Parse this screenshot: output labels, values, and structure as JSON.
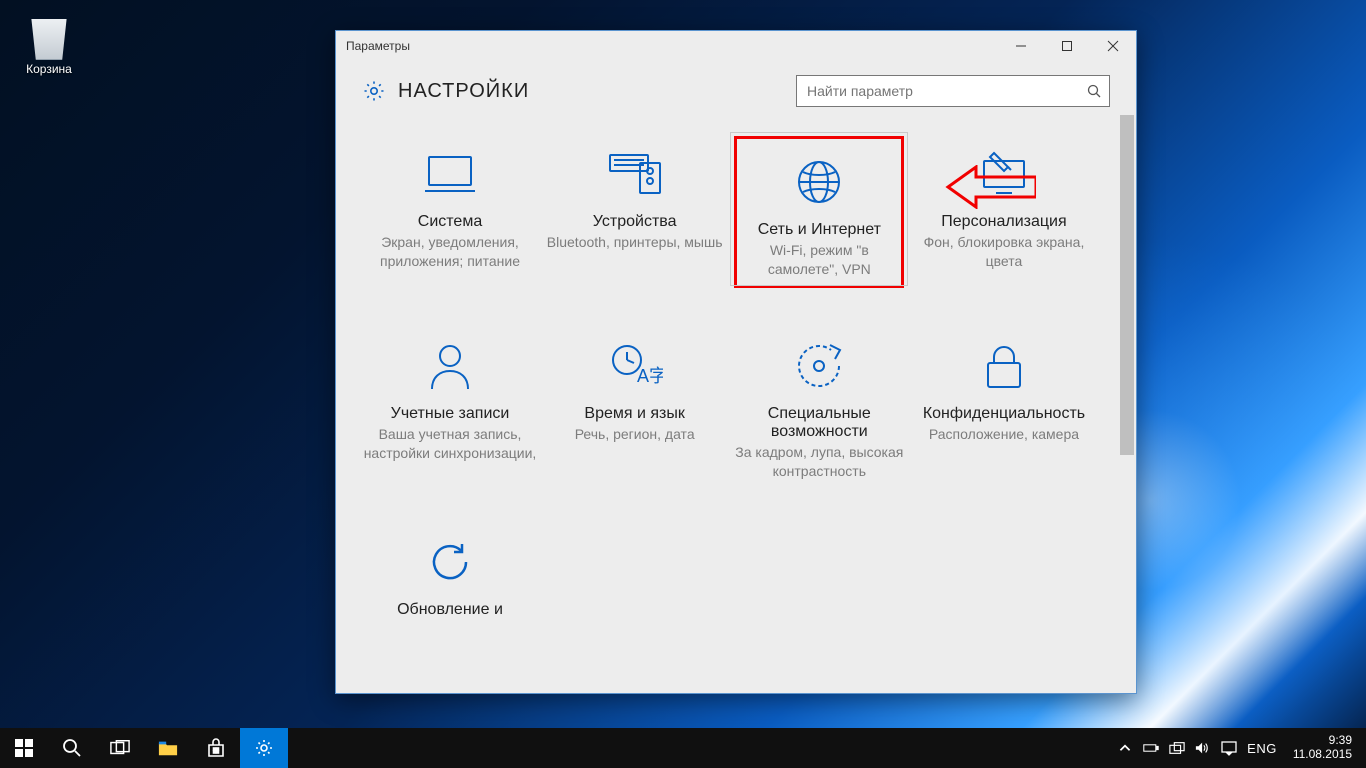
{
  "desktop": {
    "recycle_bin_label": "Корзина"
  },
  "window": {
    "title": "Параметры",
    "header_title": "НАСТРОЙКИ",
    "search_placeholder": "Найти параметр"
  },
  "tiles": {
    "system": {
      "title": "Система",
      "sub": "Экран, уведомления, приложения; питание"
    },
    "devices": {
      "title": "Устройства",
      "sub": "Bluetooth, принтеры, мышь"
    },
    "network": {
      "title": "Сеть и Интернет",
      "sub": "Wi-Fi, режим \"в самолете\", VPN"
    },
    "personalize": {
      "title": "Персонализация",
      "sub": "Фон, блокировка экрана, цвета"
    },
    "accounts": {
      "title": "Учетные записи",
      "sub": "Ваша учетная запись, настройки синхронизации,"
    },
    "time": {
      "title": "Время и язык",
      "sub": "Речь, регион, дата"
    },
    "access": {
      "title": "Специальные возможности",
      "sub": "За кадром, лупа, высокая контрастность"
    },
    "privacy": {
      "title": "Конфиденциальность",
      "sub": "Расположение, камера"
    },
    "update": {
      "title": "Обновление и",
      "sub": ""
    }
  },
  "taskbar": {
    "lang": "ENG",
    "time": "9:39",
    "date": "11.08.2015"
  }
}
